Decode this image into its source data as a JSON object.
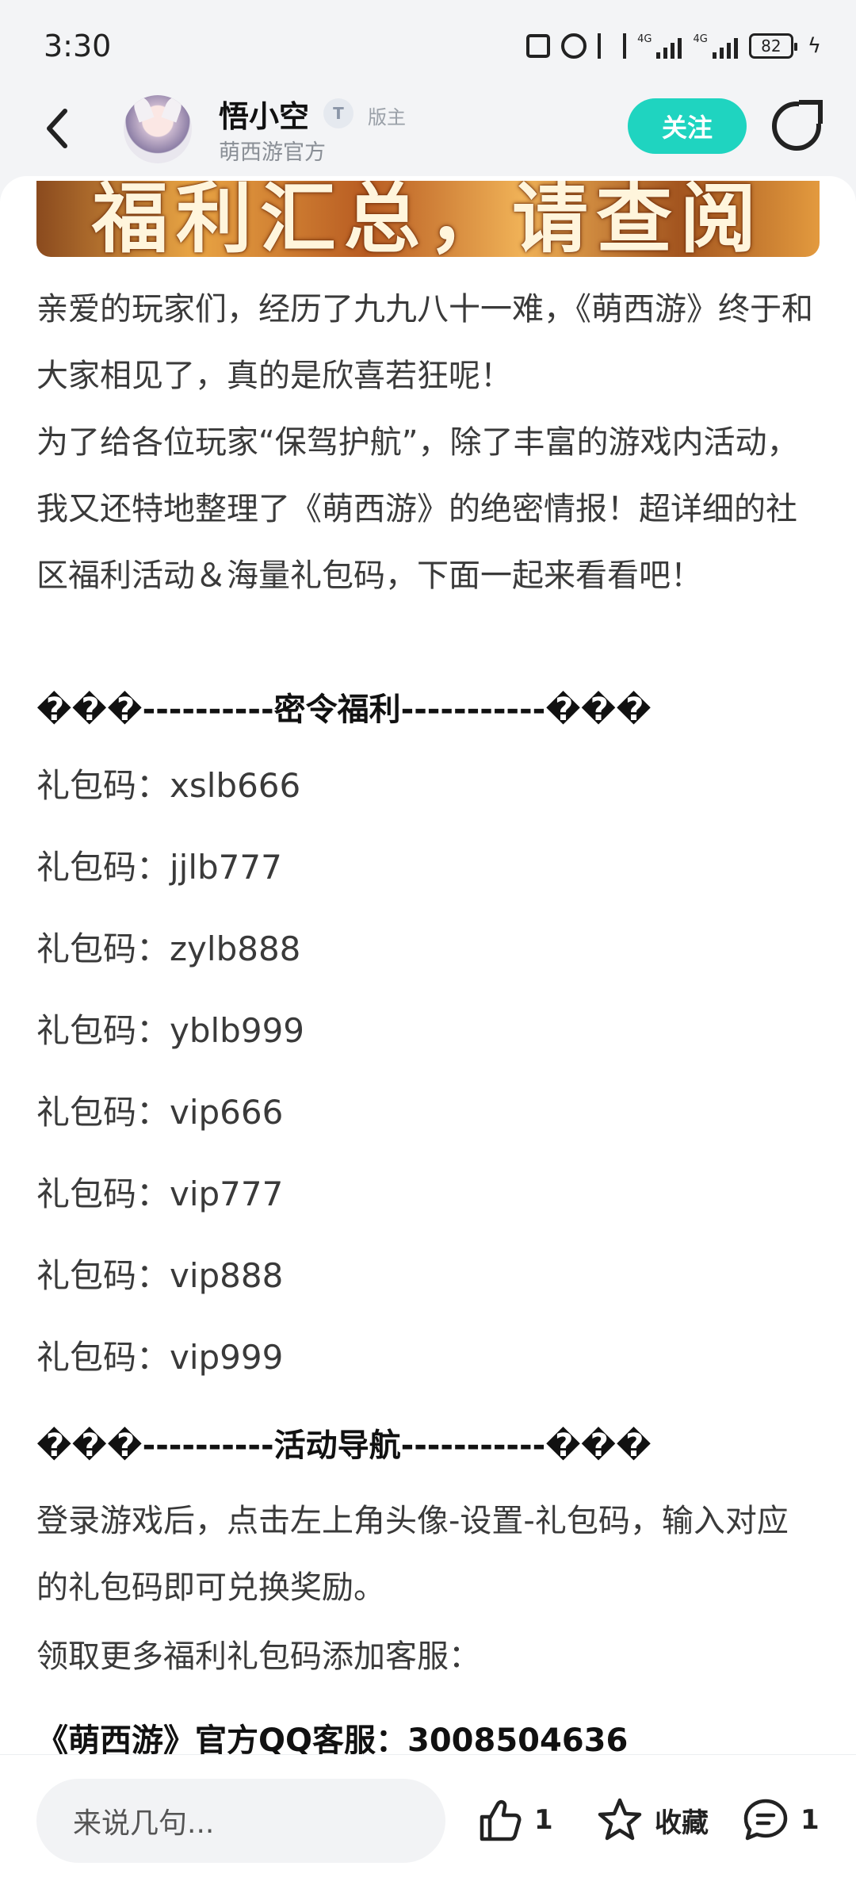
{
  "status_bar": {
    "time": "3:30",
    "network_1": "4G",
    "network_2": "4G",
    "battery": "82"
  },
  "header": {
    "author_name": "悟小空",
    "level_badge": "T",
    "role": "版主",
    "author_subtitle": "萌西游官方",
    "follow_label": "关注"
  },
  "post": {
    "banner_text": "福利汇总，请查阅",
    "paragraph_1": "亲爱的玩家们，经历了九九八十一难，《萌西游》终于和大家相见了，真的是欣喜若狂呢！",
    "paragraph_2": "为了给各位玩家“保驾护航”，除了丰富的游戏内活动，我又还特地整理了《萌西游》的绝密情报！超详细的社区福利活动＆海量礼包码，下面一起来看看吧！",
    "heading_1": "���----------密令福利-----------���",
    "gift_codes": [
      "礼包码：xslb666",
      "礼包码：jjlb777",
      "礼包码：zylb888",
      "礼包码：yblb999",
      "礼包码：vip666",
      "礼包码：vip777",
      "礼包码：vip888",
      "礼包码：vip999"
    ],
    "heading_2": "���----------活动导航-----------���",
    "paragraph_3": "登录游戏后，点击左上角头像-设置-礼包码，输入对应的礼包码即可兑换奖励。",
    "paragraph_4": "领取更多福利礼包码添加客服：",
    "qq_line": "《萌西游》官方QQ客服：3008504636"
  },
  "bottom_bar": {
    "comment_placeholder": "来说几句...",
    "like_count": "1",
    "favorite_label": "收藏",
    "comment_count": "1"
  },
  "colors": {
    "accent": "#1fd4c0",
    "background": "#f3f4f6"
  }
}
